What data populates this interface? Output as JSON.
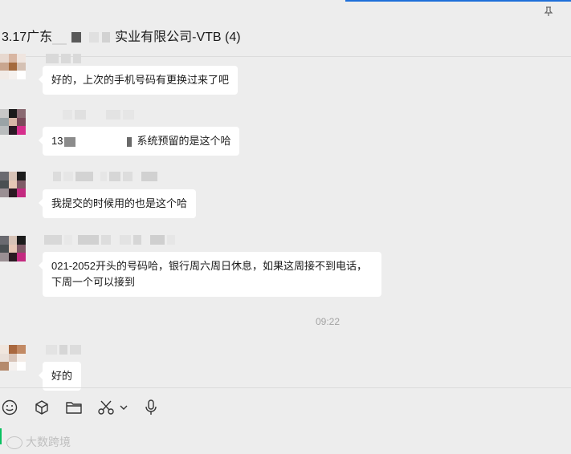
{
  "header": {
    "title_prefix": "3.17广东",
    "title_suffix": "实业有限公司-VTB (4)",
    "pin_icon": "pin-icon"
  },
  "messages": [
    {
      "text": "好的，上次的手机号码有更换过来了吧"
    },
    {
      "text_prefix": "13",
      "text_suffix": "系统预留的是这个哈"
    },
    {
      "text": "我提交的时候用的也是这个哈"
    },
    {
      "text": "021-2052开头的号码哈，银行周六周日休息，如果这周接不到电话，下周一个可以接到"
    },
    {
      "text": "好的"
    }
  ],
  "timestamp": "09:22",
  "toolbar": {
    "icons": [
      "emoji-icon",
      "package-icon",
      "folder-icon",
      "scissors-icon",
      "chevron-down-icon",
      "microphone-icon"
    ]
  },
  "watermark": "大数跨境",
  "colors": {
    "accent": "#1e6fd9",
    "cursor": "#07c160",
    "background": "#ededed",
    "bubble": "#ffffff"
  }
}
